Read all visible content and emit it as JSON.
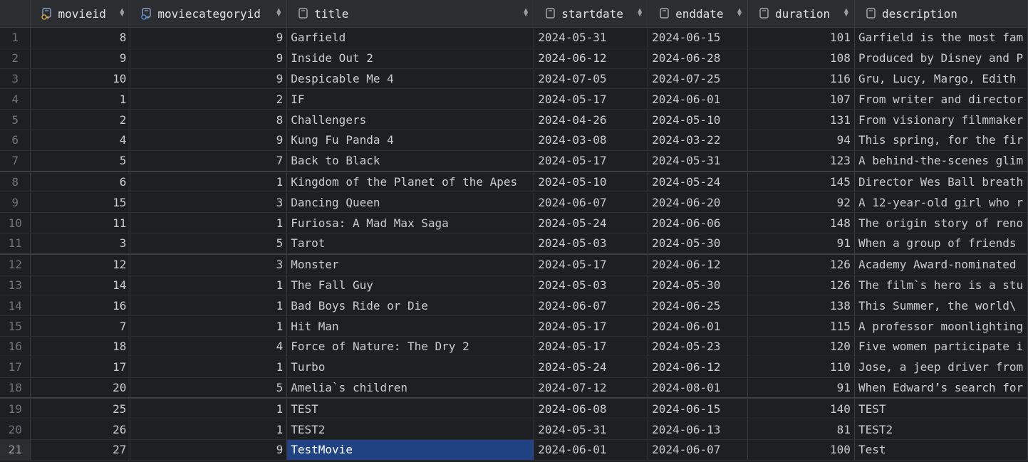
{
  "columns": [
    {
      "label": "movieid",
      "icon": "primary-key-column-icon",
      "sortable": true
    },
    {
      "label": "moviecategoryid",
      "icon": "foreign-key-column-icon",
      "sortable": true
    },
    {
      "label": "title",
      "icon": "column-icon",
      "sortable": true
    },
    {
      "label": "startdate",
      "icon": "column-icon",
      "sortable": true
    },
    {
      "label": "enddate",
      "icon": "column-icon",
      "sortable": true
    },
    {
      "label": "duration",
      "icon": "column-icon",
      "sortable": true
    },
    {
      "label": "description",
      "icon": "column-icon",
      "sortable": false
    }
  ],
  "rows": [
    {
      "n": "1",
      "movieid": "8",
      "moviecategoryid": "9",
      "title": "Garfield",
      "startdate": "2024-05-31",
      "enddate": "2024-06-15",
      "duration": "101",
      "description": "Garfield is the most fam"
    },
    {
      "n": "2",
      "movieid": "9",
      "moviecategoryid": "9",
      "title": "Inside Out 2",
      "startdate": "2024-06-12",
      "enddate": "2024-06-28",
      "duration": "108",
      "description": "Produced by Disney and P"
    },
    {
      "n": "3",
      "movieid": "10",
      "moviecategoryid": "9",
      "title": "Despicable Me 4",
      "startdate": "2024-07-05",
      "enddate": "2024-07-25",
      "duration": "116",
      "description": "Gru, Lucy, Margo, Edith"
    },
    {
      "n": "4",
      "movieid": "1",
      "moviecategoryid": "2",
      "title": "IF",
      "startdate": "2024-05-17",
      "enddate": "2024-06-01",
      "duration": "107",
      "description": "From writer and director"
    },
    {
      "n": "5",
      "movieid": "2",
      "moviecategoryid": "8",
      "title": "Challengers",
      "startdate": "2024-04-26",
      "enddate": "2024-05-10",
      "duration": "131",
      "description": "From visionary filmmaker"
    },
    {
      "n": "6",
      "movieid": "4",
      "moviecategoryid": "9",
      "title": "Kung Fu Panda 4",
      "startdate": "2024-03-08",
      "enddate": "2024-03-22",
      "duration": "94",
      "description": "This spring, for the fir"
    },
    {
      "n": "7",
      "movieid": "5",
      "moviecategoryid": "7",
      "title": "Back to Black",
      "startdate": "2024-05-17",
      "enddate": "2024-05-31",
      "duration": "123",
      "description": "A behind-the-scenes glim"
    },
    {
      "n": "8",
      "movieid": "6",
      "moviecategoryid": "1",
      "title": "Kingdom of the Planet of the Apes",
      "startdate": "2024-05-10",
      "enddate": "2024-05-24",
      "duration": "145",
      "description": "Director Wes Ball breath"
    },
    {
      "n": "9",
      "movieid": "15",
      "moviecategoryid": "3",
      "title": "Dancing Queen",
      "startdate": "2024-06-07",
      "enddate": "2024-06-20",
      "duration": "92",
      "description": "A 12-year-old girl who r"
    },
    {
      "n": "10",
      "movieid": "11",
      "moviecategoryid": "1",
      "title": "Furiosa: A Mad Max Saga",
      "startdate": "2024-05-24",
      "enddate": "2024-06-06",
      "duration": "148",
      "description": "The origin story of reno"
    },
    {
      "n": "11",
      "movieid": "3",
      "moviecategoryid": "5",
      "title": "Tarot",
      "startdate": "2024-05-03",
      "enddate": "2024-05-30",
      "duration": "91",
      "description": "When a group of friends"
    },
    {
      "n": "12",
      "movieid": "12",
      "moviecategoryid": "3",
      "title": "Monster",
      "startdate": "2024-05-17",
      "enddate": "2024-06-12",
      "duration": "126",
      "description": "Academy Award-nominated"
    },
    {
      "n": "13",
      "movieid": "14",
      "moviecategoryid": "1",
      "title": "The Fall Guy",
      "startdate": "2024-05-03",
      "enddate": "2024-05-30",
      "duration": "126",
      "description": "The film`s hero is a stu"
    },
    {
      "n": "14",
      "movieid": "16",
      "moviecategoryid": "1",
      "title": "Bad Boys Ride or Die",
      "startdate": "2024-06-07",
      "enddate": "2024-06-25",
      "duration": "138",
      "description": "This Summer, the world\\"
    },
    {
      "n": "15",
      "movieid": "7",
      "moviecategoryid": "1",
      "title": "Hit Man",
      "startdate": "2024-05-17",
      "enddate": "2024-06-01",
      "duration": "115",
      "description": "A professor moonlighting"
    },
    {
      "n": "16",
      "movieid": "18",
      "moviecategoryid": "4",
      "title": "Force of Nature: The Dry 2",
      "startdate": "2024-05-17",
      "enddate": "2024-05-23",
      "duration": "120",
      "description": "Five women participate i"
    },
    {
      "n": "17",
      "movieid": "17",
      "moviecategoryid": "1",
      "title": "Turbo",
      "startdate": "2024-05-24",
      "enddate": "2024-06-12",
      "duration": "110",
      "description": "Jose, a jeep driver from"
    },
    {
      "n": "18",
      "movieid": "20",
      "moviecategoryid": "5",
      "title": "Amelia`s children",
      "startdate": "2024-07-12",
      "enddate": "2024-08-01",
      "duration": "91",
      "description": "When Edward’s search for"
    },
    {
      "n": "19",
      "movieid": "25",
      "moviecategoryid": "1",
      "title": "TEST",
      "startdate": "2024-06-08",
      "enddate": "2024-06-15",
      "duration": "140",
      "description": "TEST"
    },
    {
      "n": "20",
      "movieid": "26",
      "moviecategoryid": "1",
      "title": "TEST2",
      "startdate": "2024-05-31",
      "enddate": "2024-06-13",
      "duration": "81",
      "description": "TEST2"
    },
    {
      "n": "21",
      "movieid": "27",
      "moviecategoryid": "9",
      "title": "TestMovie",
      "startdate": "2024-06-01",
      "enddate": "2024-06-07",
      "duration": "100",
      "description": "Test"
    }
  ],
  "selection": {
    "row": "21",
    "column": "title"
  },
  "colors": {
    "background": "#1e1f22",
    "header": "#2b2d30",
    "selection": "#214283",
    "pk_icon": "#d4a84a",
    "fk_icon": "#5c8fd6"
  }
}
